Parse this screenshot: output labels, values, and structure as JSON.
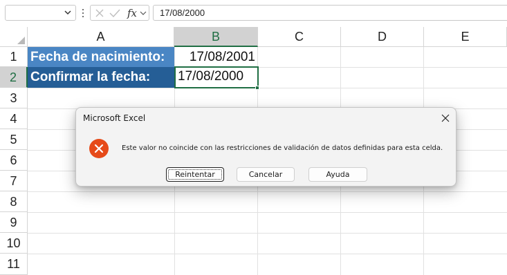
{
  "formula_bar": {
    "name_box_value": "",
    "fx_label": "fx",
    "formula_value": "17/08/2000"
  },
  "columns": [
    "A",
    "B",
    "C",
    "D",
    "E"
  ],
  "selected_column": "B",
  "rows": [
    "1",
    "2",
    "3",
    "4",
    "5",
    "6",
    "7",
    "8",
    "9",
    "10",
    "11"
  ],
  "selected_row": "2",
  "cells": {
    "A1": "Fecha de nacimiento:",
    "B1": "17/08/2001",
    "A2": "Confirmar la fecha:",
    "B2": "17/08/2000"
  },
  "dialog": {
    "title": "Microsoft Excel",
    "icon": "error-icon",
    "message": "Este valor no coincide con las restricciones de validación de datos definidas para esta celda.",
    "buttons": {
      "retry": "Reintentar",
      "cancel": "Cancelar",
      "help": "Ayuda"
    }
  },
  "colors": {
    "accent_green": "#1f6e43",
    "label_blue": "#4a86c4",
    "label_dark_blue": "#255e96",
    "error_red": "#e64a19"
  }
}
